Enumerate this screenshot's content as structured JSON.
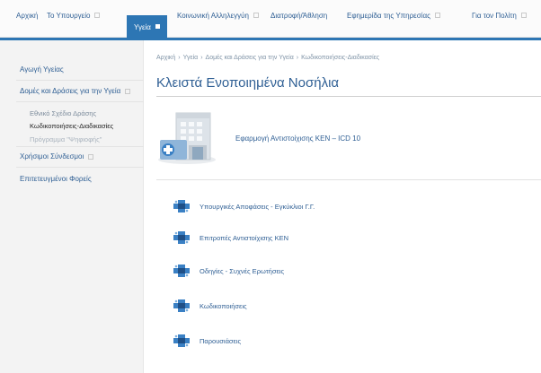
{
  "topnav": {
    "tabs": [
      {
        "label": "Αρχική",
        "dropdown": false,
        "active": false
      },
      {
        "label": "Το Υπουργείο",
        "dropdown": true,
        "active": false
      },
      {
        "label": "Υγεία",
        "dropdown": true,
        "active": true
      },
      {
        "label": "Κοινωνική Αλληλεγγύη",
        "dropdown": true,
        "active": false
      },
      {
        "label": "Διατροφή/Άθληση",
        "dropdown": false,
        "active": false
      },
      {
        "label": "Εφημερίδα της Υπηρεσίας",
        "dropdown": true,
        "active": false
      },
      {
        "label": "Για τον Πολίτη",
        "dropdown": true,
        "active": false
      }
    ]
  },
  "sidebar": {
    "items": [
      {
        "label": "Αγωγή Υγείας"
      },
      {
        "label": "Δομές και Δράσεις για την Υγεία"
      },
      {
        "label": "Χρήσιμοι Σύνδεσμοι"
      },
      {
        "label": "Επιτετευγμένοι Φορείς"
      }
    ],
    "subitems": [
      {
        "label": "Εθνικό Σχέδιο Δράσης"
      },
      {
        "label": "Κωδικοποιήσεις-Διαδικασίες"
      },
      {
        "label": "Πρόγραμμα \"Ψηφιοφής\""
      }
    ]
  },
  "main": {
    "breadcrumb": [
      "Αρχική",
      "›",
      "Υγεία",
      "›",
      "Δομές και Δράσεις για την Υγεία",
      "›",
      "Κωδικοποιήσεις-Διαδικασίες"
    ],
    "title": "Κλειστά Ενοποιημένα Νοσήλια",
    "hero_link": "Εφαρμογή Αντιστοίχισης ΚΕΝ – ICD 10",
    "links": [
      {
        "label": "Υπουργικές Αποφάσεις - Εγκύκλιοι Γ.Γ."
      },
      {
        "label": "Επιτροπές Αντιστοίχισης ΚΕΝ"
      },
      {
        "label": "Οδηγίες - Συχνές Ερωτήσεις"
      },
      {
        "label": "Κωδικοποιήσεις"
      },
      {
        "label": "Παρουσιάσεις"
      }
    ]
  },
  "colors": {
    "accent": "#2d76b4",
    "link": "#2f5f94",
    "cross_blue": "#3a80c4",
    "cross_dark": "#1f4f86"
  },
  "icons": {
    "hero": "hospital-building-icon",
    "link": "medical-cross-icon",
    "dropdown": "dropdown-square-icon"
  }
}
